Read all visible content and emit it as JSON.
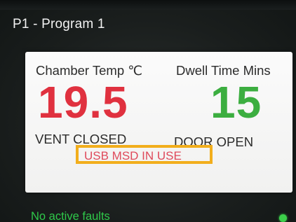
{
  "header": {
    "program_title": "P1 - Program 1"
  },
  "panel": {
    "chamber_temp_label": "Chamber Temp ℃",
    "chamber_temp_value": "19.5",
    "dwell_time_label": "Dwell Time Mins",
    "dwell_time_value": "15",
    "vent_status": "VENT CLOSED",
    "door_status": "DOOR OPEN",
    "usb_status": "USB MSD IN USE"
  },
  "footer": {
    "faults_text": "No active faults"
  },
  "colors": {
    "temp_value": "#e0313f",
    "dwell_value": "#3cae40",
    "usb_text": "#df4a5b",
    "usb_highlight": "#f2ae1c",
    "faults_text": "#2fc94a",
    "status_dot": "#3ccf4a",
    "panel_bg": "#f7f7f6",
    "screen_bg": "#1b1f1f"
  },
  "icons": {
    "status_indicator": "green-status-dot"
  }
}
